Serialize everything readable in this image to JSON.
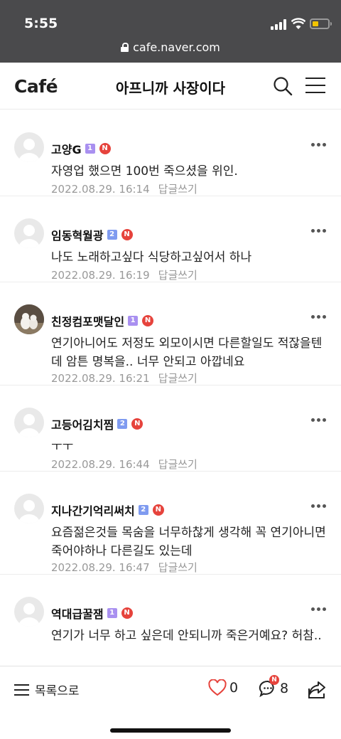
{
  "status": {
    "time": "5:55"
  },
  "browser": {
    "url": "cafe.naver.com"
  },
  "header": {
    "logo": "Café",
    "title": "아프니까 사장이다"
  },
  "comments": [
    {
      "nickname": "고양G",
      "level": "1",
      "badge": "N",
      "text": "자영업 했으면 100번 죽으셨을 위인.",
      "date": "2022.08.29. 16:14",
      "reply": "답글쓰기"
    },
    {
      "nickname": "임동혁월광",
      "level": "2",
      "badge": "N",
      "text": "나도 노래하고싶다 식당하고싶어서 하나",
      "date": "2022.08.29. 16:19",
      "reply": "답글쓰기"
    },
    {
      "nickname": "친정컴포맷달인",
      "level": "1",
      "badge": "N",
      "text": "연기아니어도 저정도 외모이시면 다른할일도 적잖을텐데 암튼 명복을.. 너무 안되고 아깝네요",
      "date": "2022.08.29. 16:21",
      "reply": "답글쓰기"
    },
    {
      "nickname": "고등어김치찜",
      "level": "2",
      "badge": "N",
      "text": "ㅜㅜ",
      "date": "2022.08.29. 16:44",
      "reply": "답글쓰기"
    },
    {
      "nickname": "지나간기억리써치",
      "level": "2",
      "badge": "N",
      "text": "요즘젊은것들 목숨을 너무하찮게 생각해 꼭 연기아니면 죽어야하나 다른길도 있는데",
      "date": "2022.08.29. 16:47",
      "reply": "답글쓰기"
    },
    {
      "nickname": "역대급꿀잼",
      "level": "1",
      "badge": "N",
      "text": "연기가 너무 하고 싶은데 안되니까 죽은거예요? 허참..",
      "date": "",
      "reply": ""
    }
  ],
  "toolbar": {
    "list_label": "목록으로",
    "like_count": "0",
    "comment_count": "8",
    "comment_badge": "N"
  },
  "colors": {
    "badge_red": "#e6433c",
    "level_purple": "#a990f0",
    "level_blue": "#7f9bf0",
    "status_bg": "#4a4a4c"
  }
}
